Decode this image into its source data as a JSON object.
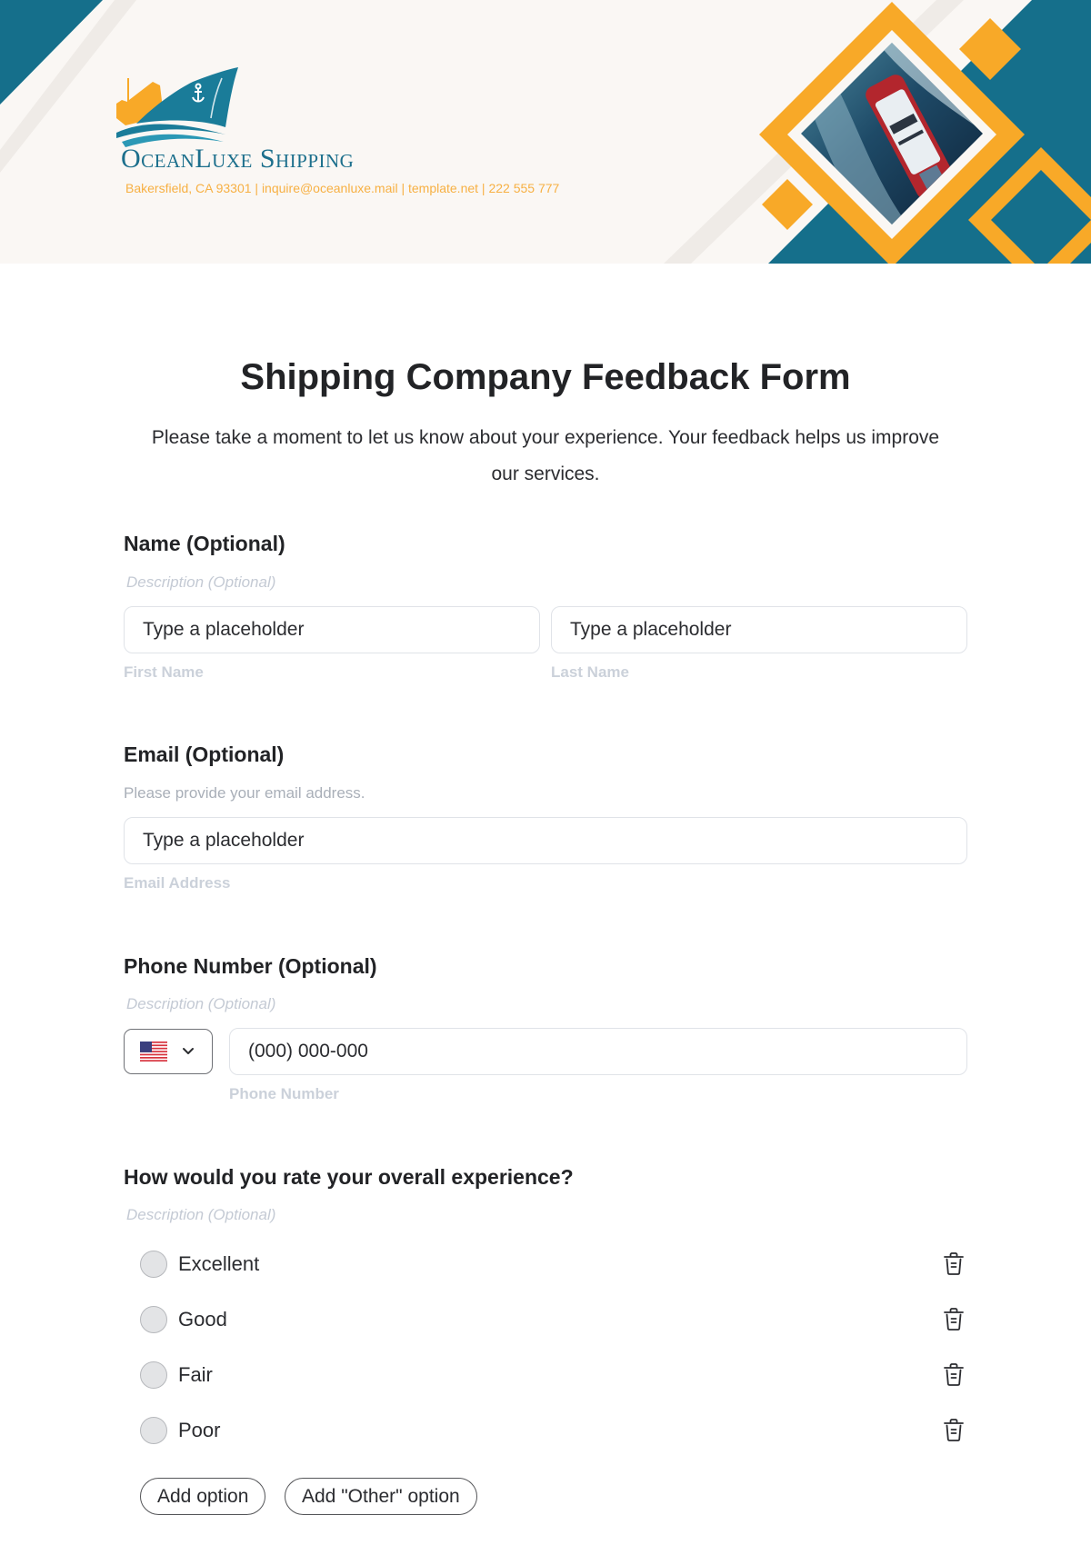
{
  "header": {
    "company_name": "OceanLuxe Shipping",
    "contact_line": "Bakersfield, CA 93301 | inquire@oceanluxe.mail | template.net | 222 555 777",
    "logo_icon": "ship-anchor-logo-icon",
    "banner_image": "ship-aerial-photo",
    "colors": {
      "teal": "#156f8b",
      "orange": "#f8a928",
      "cream": "#faf7f4"
    }
  },
  "form": {
    "title": "Shipping Company Feedback Form",
    "subtitle": "Please take a moment to let us know about your experience. Your feedback helps us improve our services."
  },
  "name_field": {
    "label": "Name (Optional)",
    "description": "Description (Optional)",
    "first": {
      "placeholder": "Type a placeholder",
      "sublabel": "First Name"
    },
    "last": {
      "placeholder": "Type a placeholder",
      "sublabel": "Last Name"
    }
  },
  "email_field": {
    "label": "Email (Optional)",
    "help": "Please provide your email address.",
    "placeholder": "Type a placeholder",
    "sublabel": "Email Address"
  },
  "phone_field": {
    "label": "Phone Number (Optional)",
    "description": "Description (Optional)",
    "country": {
      "selected": "US",
      "icon": "us-flag-icon"
    },
    "placeholder": "(000) 000-000",
    "sublabel": "Phone Number"
  },
  "rating_field": {
    "label": "How would you rate your overall experience?",
    "description": "Description (Optional)",
    "options": [
      {
        "label": "Excellent",
        "selected": false
      },
      {
        "label": "Good",
        "selected": false
      },
      {
        "label": "Fair",
        "selected": false
      },
      {
        "label": "Poor",
        "selected": false
      }
    ],
    "add_option_label": "Add option",
    "add_other_label": "Add \"Other\" option"
  }
}
